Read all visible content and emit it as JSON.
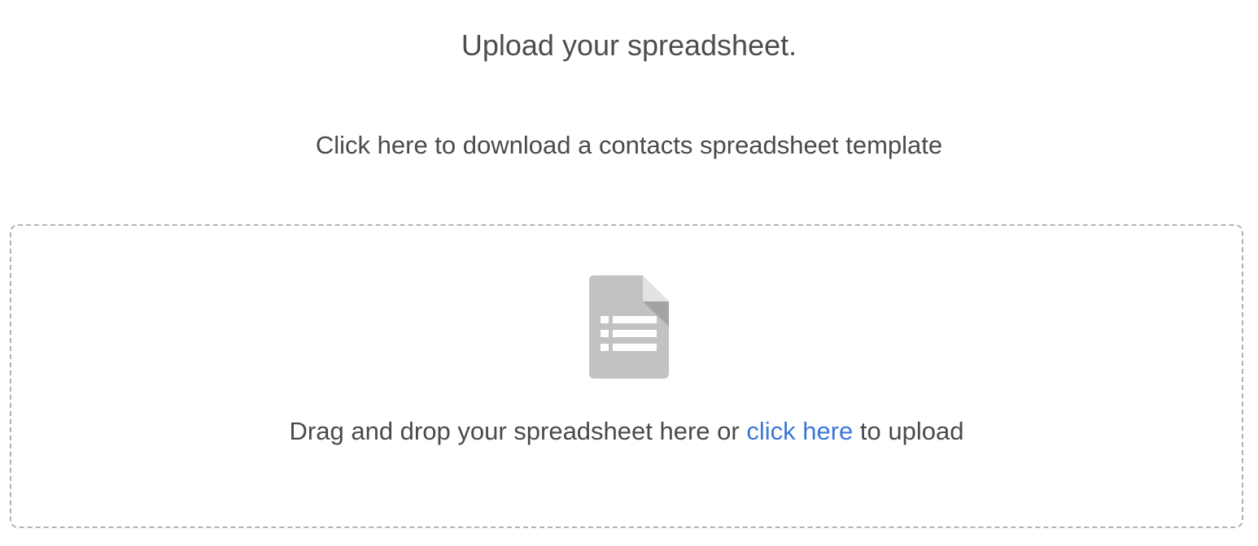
{
  "header": {
    "title": "Upload your spreadsheet."
  },
  "template": {
    "link_text": "Click here to download a contacts spreadsheet template"
  },
  "dropzone": {
    "icon": "spreadsheet-file-icon",
    "text_before": "Drag and drop your spreadsheet here or ",
    "link_text": "click here",
    "text_after": " to upload"
  },
  "colors": {
    "link": "#3a78d8",
    "icon": "#c2c2c2",
    "border": "#b3b3b3"
  }
}
